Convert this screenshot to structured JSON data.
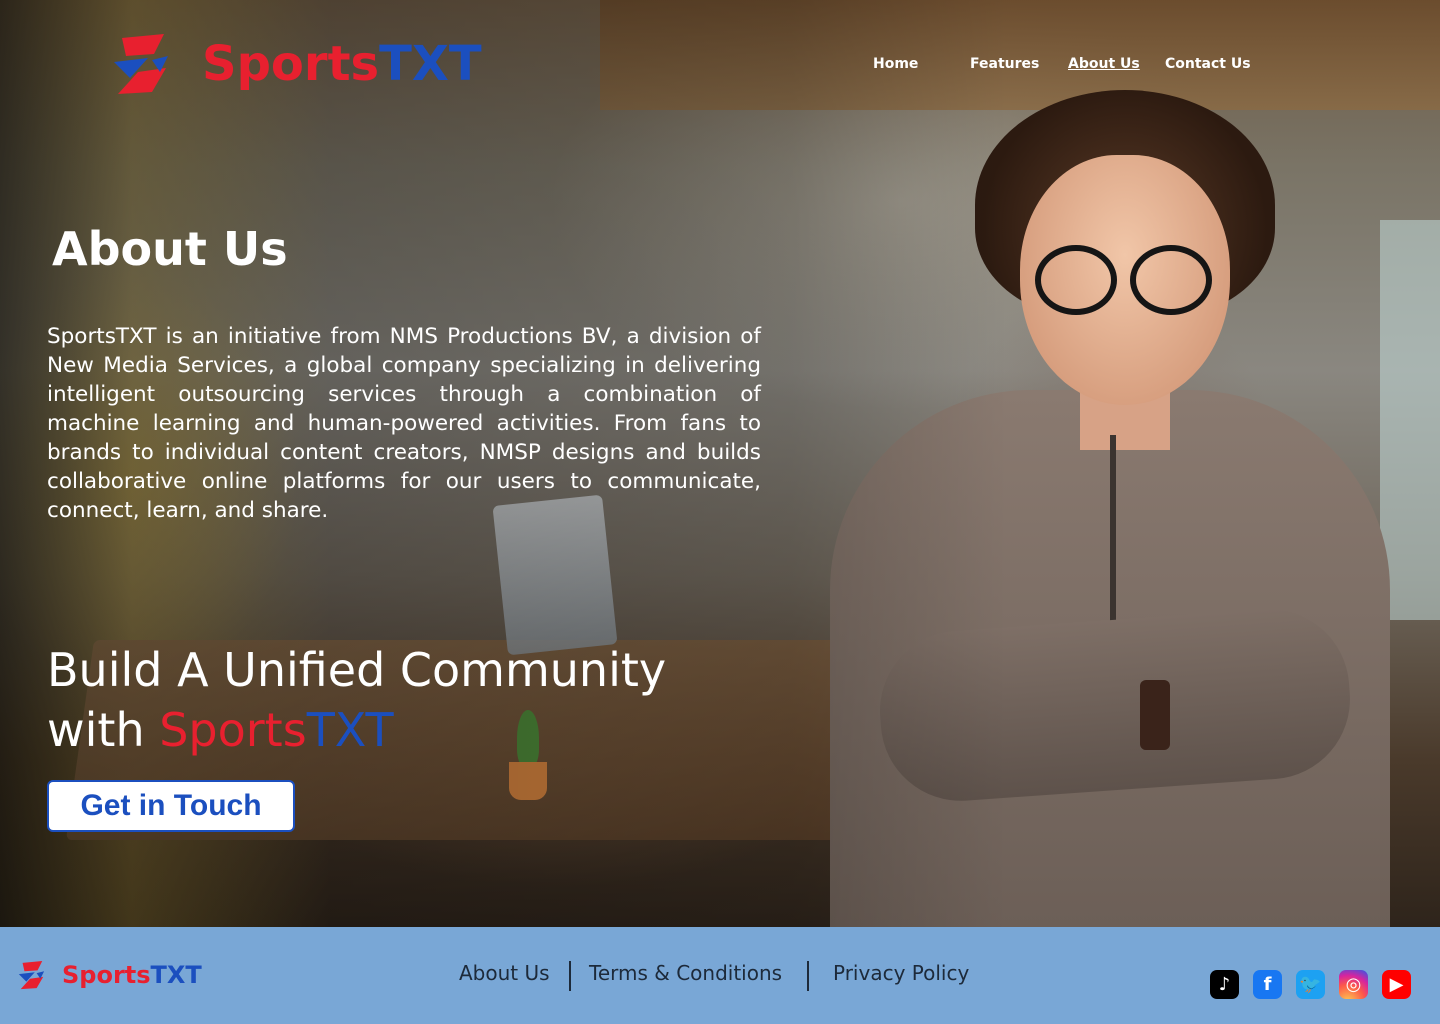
{
  "brand": {
    "part1": "Sports",
    "part2": "TXT",
    "red": "#e8202f",
    "blue": "#1b4fbf"
  },
  "nav": {
    "items": [
      {
        "label": "Home"
      },
      {
        "label": "Features"
      },
      {
        "label": "About Us",
        "active": true
      },
      {
        "label": "Contact Us"
      }
    ]
  },
  "hero": {
    "title": "About Us",
    "paragraph": "SportsTXT is an initiative from NMS Productions BV, a division of New Media Services, a global company specializing in delivering intelligent outsourcing services through a combination of machine learning and human-powered activities. From fans to brands to individual content creators, NMSP designs and builds collaborative online platforms for our users to communicate, connect, learn, and share.",
    "headline_line1": "Build A Unified Community",
    "headline_with": "with ",
    "headline_sports": "Sports",
    "headline_txt": "TXT",
    "cta_label": "Get in Touch"
  },
  "footer": {
    "background": "#79a7d6",
    "links": [
      {
        "label": "About Us"
      },
      {
        "label": "Terms & Conditions"
      },
      {
        "label": "Privacy Policy"
      }
    ],
    "socials": [
      {
        "icon": "tiktok-icon",
        "glyph": "♪"
      },
      {
        "icon": "facebook-icon",
        "glyph": "f"
      },
      {
        "icon": "twitter-icon",
        "glyph": "🐦"
      },
      {
        "icon": "instagram-icon",
        "glyph": "◎"
      },
      {
        "icon": "youtube-icon",
        "glyph": "▶"
      }
    ]
  }
}
